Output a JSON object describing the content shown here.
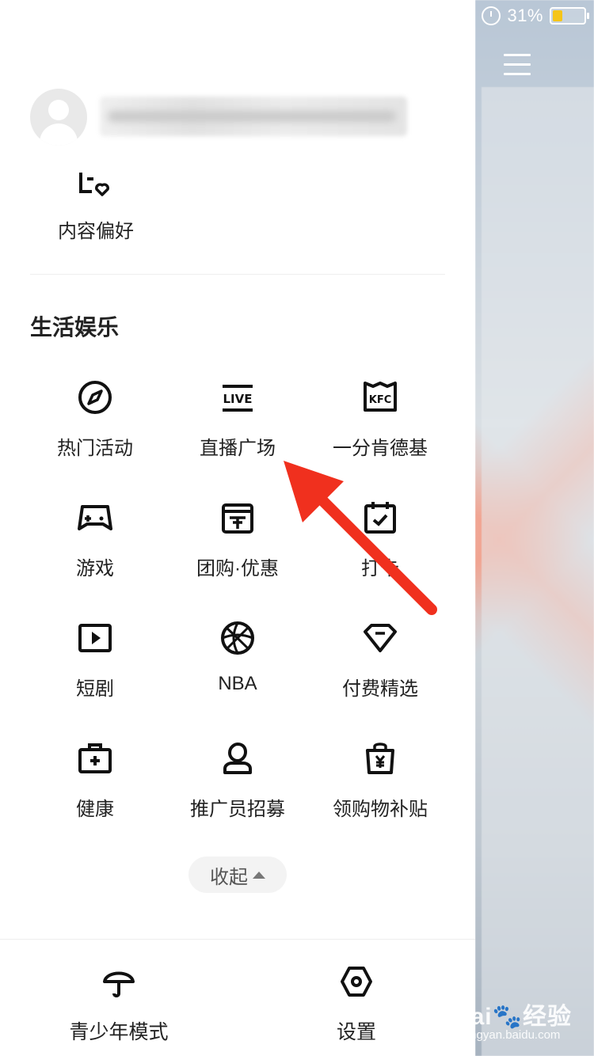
{
  "status_bar": {
    "battery_percent": "31%",
    "battery_level": 0.31,
    "alarm_icon": "alarm-icon"
  },
  "drawer": {
    "profile": {
      "avatar_icon": "user-avatar-icon"
    },
    "content_pref": {
      "label": "内容偏好",
      "icon": "heart-list-icon"
    },
    "section_title": "生活娱乐",
    "grid": [
      {
        "label": "热门活动",
        "icon": "compass-icon"
      },
      {
        "label": "直播广场",
        "icon": "live-icon"
      },
      {
        "label": "一分肯德基",
        "icon": "kfc-icon"
      },
      {
        "label": "游戏",
        "icon": "gamepad-icon"
      },
      {
        "label": "团购·优惠",
        "icon": "coupon-icon"
      },
      {
        "label": "打卡",
        "icon": "calendar-check-icon"
      },
      {
        "label": "短剧",
        "icon": "play-box-icon"
      },
      {
        "label": "NBA",
        "icon": "basketball-icon"
      },
      {
        "label": "付费精选",
        "icon": "diamond-icon"
      },
      {
        "label": "健康",
        "icon": "medical-kit-icon"
      },
      {
        "label": "推广员招募",
        "icon": "promoter-icon"
      },
      {
        "label": "领购物补贴",
        "icon": "shopping-bag-yen-icon"
      }
    ],
    "collapse_label": "收起",
    "bottom": [
      {
        "label": "青少年模式",
        "icon": "umbrella-icon"
      },
      {
        "label": "设置",
        "icon": "hexagon-settings-icon"
      }
    ]
  },
  "annotation": {
    "arrow_color": "#f0301e"
  },
  "watermark": {
    "main": "Bai",
    "main2": "经验",
    "sub": "jingyan.baidu.com"
  }
}
